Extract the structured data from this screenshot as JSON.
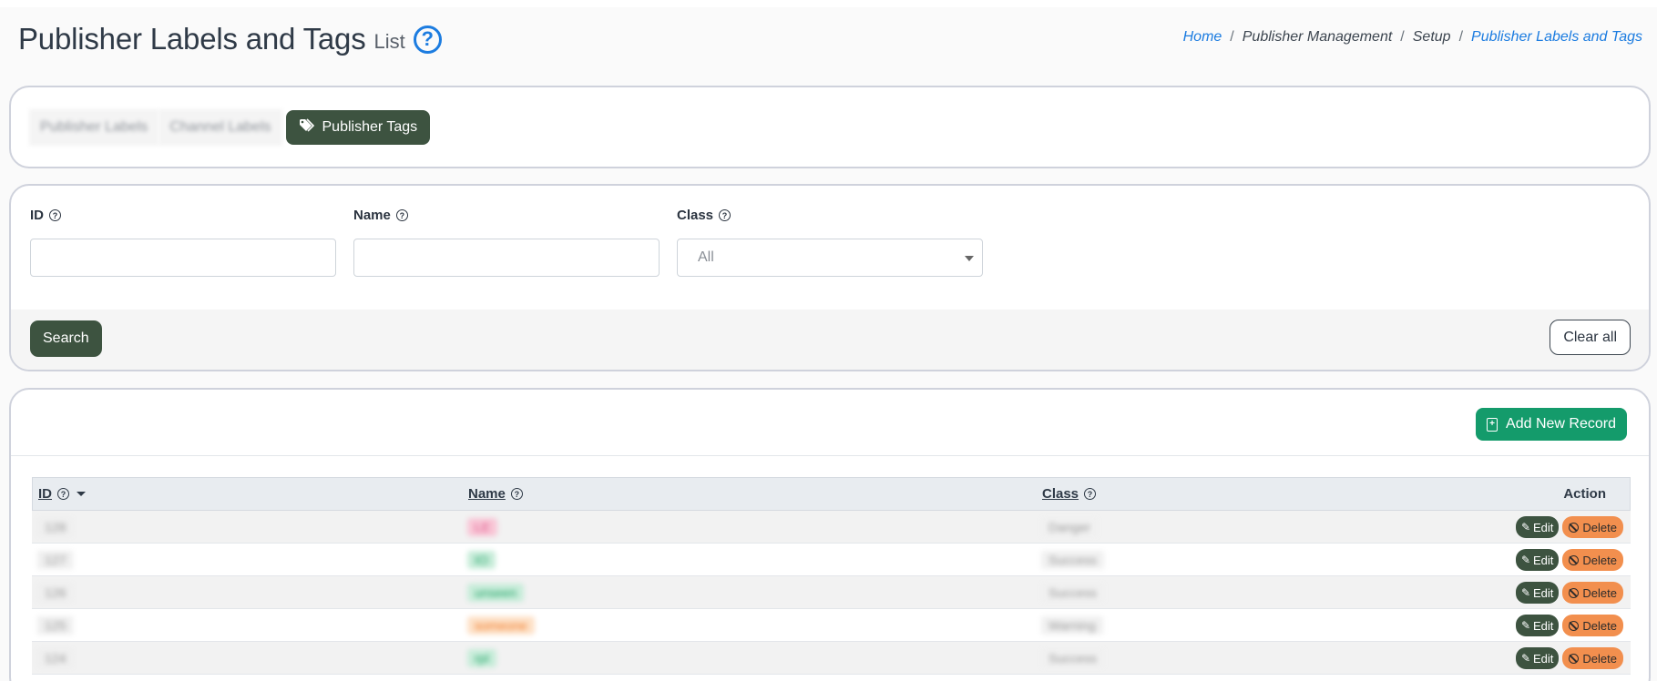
{
  "header": {
    "title": "Publisher Labels and Tags",
    "subtitle": "List",
    "help_glyph": "?"
  },
  "breadcrumb": {
    "items": [
      "Home",
      "Publisher Management",
      "Setup",
      "Publisher Labels and Tags"
    ],
    "separator": "/"
  },
  "tabs": {
    "blurred": [
      "Publisher Labels",
      "Channel Labels"
    ],
    "active": "Publisher Tags"
  },
  "filters": {
    "id_label": "ID",
    "name_label": "Name",
    "class_label": "Class",
    "class_selected": "All",
    "id_value": "",
    "name_value": ""
  },
  "actions": {
    "search": "Search",
    "clear_all": "Clear all",
    "add_new": "Add New Record"
  },
  "table": {
    "columns": [
      "ID",
      "Name",
      "Class",
      "Action"
    ],
    "sort_column": "ID",
    "rows": [
      {
        "id": "128",
        "name": "LE",
        "class": "Danger",
        "name_color": "#f8c6d6",
        "name_text_color": "#e0558a"
      },
      {
        "id": "127",
        "name": "IO",
        "class": "Success",
        "name_color": "#c7ecd9",
        "name_text_color": "#25a56a"
      },
      {
        "id": "126",
        "name": "unseen",
        "class": "Success",
        "name_color": "#c7ecd9",
        "name_text_color": "#25a56a"
      },
      {
        "id": "125",
        "name": "someone",
        "class": "Warning",
        "name_color": "#fde0c6",
        "name_text_color": "#f07c2a"
      },
      {
        "id": "124",
        "name": "rpl",
        "class": "Success",
        "name_color": "#c7ecd9",
        "name_text_color": "#25a56a"
      }
    ],
    "edit_label": "Edit",
    "delete_label": "Delete"
  },
  "colors": {
    "primary_dark": "#3d5340",
    "accent_green": "#149b6b",
    "link_blue": "#1c7ce0",
    "delete_orange": "#f28f4e"
  },
  "icons": {
    "help": "question-circle-icon",
    "tag": "tags-icon",
    "add": "file-plus-icon",
    "edit": "edit-icon",
    "delete": "ban-icon",
    "sort": "caret-down-icon"
  }
}
